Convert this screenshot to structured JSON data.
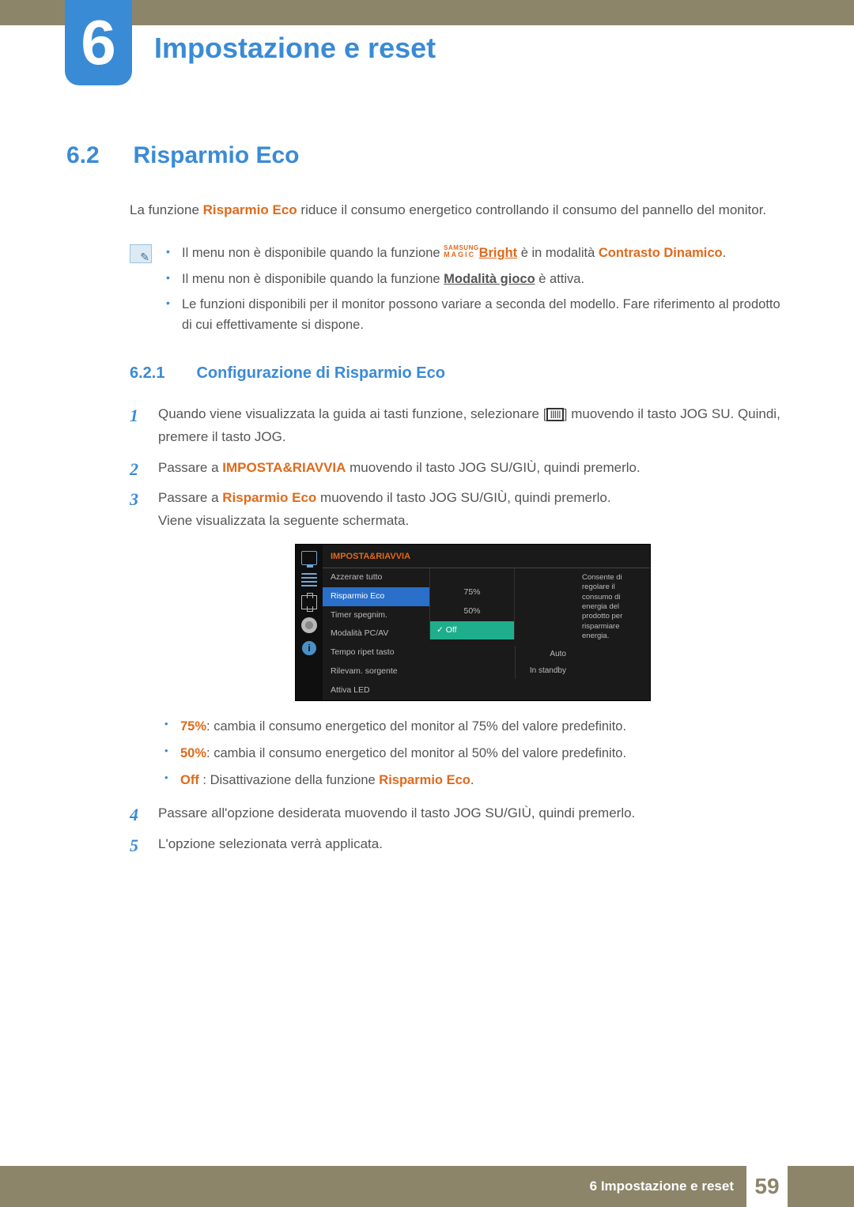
{
  "chapter": {
    "number": "6",
    "title": "Impostazione e reset"
  },
  "section": {
    "number": "6.2",
    "title": "Risparmio Eco",
    "intro_pre": "La funzione ",
    "intro_bold": "Risparmio Eco",
    "intro_post": " riduce il consumo energetico controllando il consumo del pannello del monitor."
  },
  "notes": {
    "n1_pre": "Il menu non è disponibile quando la funzione ",
    "n1_brand_top": "SAMSUNG",
    "n1_brand_bottom": "MAGIC",
    "n1_bright": "Bright",
    "n1_mid": " è in modalità ",
    "n1_mode": "Contrasto Dinamico",
    "n1_post": ".",
    "n2_pre": "Il menu non è disponibile quando la funzione ",
    "n2_mode": "Modalità gioco",
    "n2_post": " è attiva.",
    "n3": "Le funzioni disponibili per il monitor possono variare a seconda del modello. Fare riferimento al prodotto di cui effettivamente si dispone."
  },
  "subsection": {
    "number": "6.2.1",
    "title": "Configurazione di Risparmio Eco"
  },
  "steps": {
    "s1a": "Quando viene visualizzata la guida ai tasti funzione, selezionare [",
    "s1_icon": "ⅢⅡ",
    "s1b": "] muovendo il tasto JOG SU. Quindi, premere il tasto JOG.",
    "s2_pre": "Passare a ",
    "s2_bold": "IMPOSTA&RIAVVIA",
    "s2_post": " muovendo il tasto JOG SU/GIÙ, quindi premerlo.",
    "s3_pre": "Passare a ",
    "s3_bold": "Risparmio Eco",
    "s3_post": " muovendo il tasto JOG SU/GIÙ, quindi premerlo.",
    "s3_extra": "Viene visualizzata la seguente schermata.",
    "s4": "Passare all'opzione desiderata muovendo il tasto JOG SU/GIÙ, quindi premerlo.",
    "s5": "L'opzione selezionata verrà applicata."
  },
  "bullets": {
    "b1_bold": "75%",
    "b1_text": ": cambia il consumo energetico del monitor al 75% del valore predefinito.",
    "b2_bold": "50%",
    "b2_text": ": cambia il consumo energetico del monitor al 50% del valore predefinito.",
    "b3_bold": "Off",
    "b3_mid": " : Disattivazione della funzione ",
    "b3_bold2": "Risparmio Eco",
    "b3_post": "."
  },
  "osd": {
    "title": "IMPOSTA&RIAVVIA",
    "rows": {
      "r1": "Azzerare tutto",
      "r2": "Risparmio Eco",
      "r3": "Timer spegnim.",
      "r4": "Modalità PC/AV",
      "r5": "Tempo ripet tasto",
      "r6": "Rilevam. sorgente",
      "r7": "Attiva LED"
    },
    "opts": {
      "o1": "75%",
      "o2": "50%",
      "o3": "Off"
    },
    "vals": {
      "v1": "Auto",
      "v2": "In standby"
    },
    "desc": "Consente di regolare il consumo di energia del prodotto per risparmiare energia."
  },
  "footer": {
    "text": "6 Impostazione e reset",
    "page": "59"
  }
}
